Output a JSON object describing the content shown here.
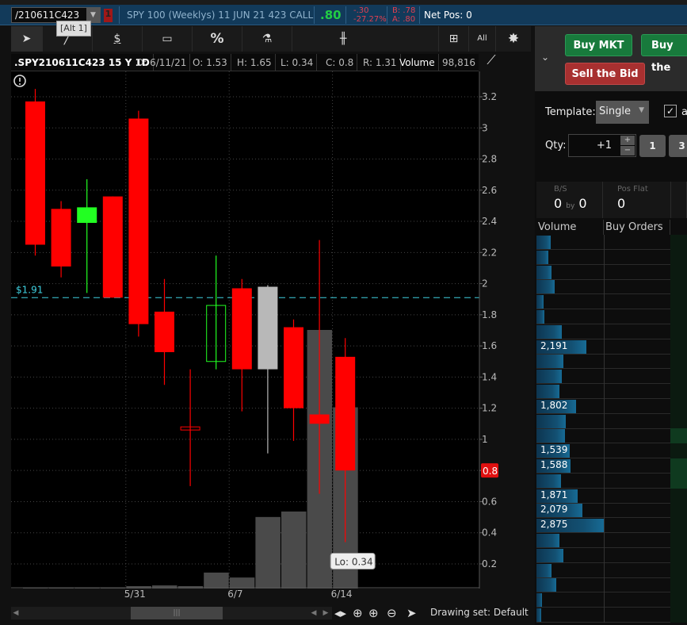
{
  "symbol_bar": {
    "symbol": "/210611C423",
    "link_badge": "1",
    "tooltip": "[Alt 1]",
    "description": "SPY 100 (Weeklys) 11 JUN 21 423 CALL",
    "last": ".80",
    "change": "-.30",
    "change_pct": "-27.27%",
    "bid": "B: .78",
    "ask": "A: .80",
    "net_pos": "Net Pos: 0"
  },
  "toolbar": {
    "icons": [
      "cursor-icon",
      "drawing-pencil-icon",
      "price-dollar-icon",
      "rectangle-icon",
      "percent-icon",
      "studies-flask-icon",
      "chart-style-candle-icon",
      "grid-layout-icon",
      "all-icon",
      "gear-icon"
    ],
    "all_label": "All",
    "percent_label": "%",
    "dollar_label": "$"
  },
  "info": {
    "title": ".SPY210611C423 15 Y 1D",
    "date": "D: 6/11/21",
    "open": "O: 1.53",
    "high": "H: 1.65",
    "low": "L: 0.34",
    "close": "C: 0.8",
    "range": "R: 1.31",
    "volume_label": "Volume",
    "volume_value": "98,816"
  },
  "chart_data": {
    "type": "candlestick",
    "ylim": [
      0.042,
      3.363
    ],
    "yticks": [
      3.2,
      3,
      2.8,
      2.6,
      2.4,
      2.2,
      2,
      1.8,
      1.6,
      1.4,
      1.2,
      1,
      0.8,
      0.6,
      0.4,
      0.2
    ],
    "ytick_labels": [
      "3.2",
      "3",
      "2.8",
      "2.6",
      "2.4",
      "2.2",
      "2",
      "1.8",
      "1.6",
      "1.4",
      "1.2",
      "1",
      "0.8",
      "0.6",
      "0.4",
      "0.2"
    ],
    "xtick_labels": [
      "5/31",
      "6/7",
      "6/14"
    ],
    "xtick_after_index": [
      3,
      7,
      11
    ],
    "candles": [
      {
        "o": 3.17,
        "h": 3.25,
        "l": 2.18,
        "c": 2.25,
        "color": "#ff0000",
        "hollow": false
      },
      {
        "o": 2.48,
        "h": 2.53,
        "l": 2.04,
        "c": 2.11,
        "color": "#ff0000",
        "hollow": false
      },
      {
        "o": 2.39,
        "h": 2.67,
        "l": 1.94,
        "c": 2.49,
        "color": "#22ff22",
        "hollow": false
      },
      {
        "o": 2.56,
        "h": 2.56,
        "l": 1.91,
        "c": 1.91,
        "color": "#ff0000",
        "hollow": false
      },
      {
        "o": 3.06,
        "h": 3.11,
        "l": 1.66,
        "c": 1.74,
        "color": "#ff0000",
        "hollow": false
      },
      {
        "o": 1.82,
        "h": 2.03,
        "l": 1.35,
        "c": 1.56,
        "color": "#ff0000",
        "hollow": false
      },
      {
        "o": 1.06,
        "h": 1.45,
        "l": 0.7,
        "c": 1.08,
        "color": "#ff0000",
        "hollow": true
      },
      {
        "o": 1.5,
        "h": 2.18,
        "l": 1.45,
        "c": 1.86,
        "color": "#22ff22",
        "hollow": true
      },
      {
        "o": 1.97,
        "h": 2.03,
        "l": 1.18,
        "c": 1.45,
        "color": "#ff0000",
        "hollow": false
      },
      {
        "o": 1.98,
        "h": 1.99,
        "l": 0.91,
        "c": 1.45,
        "color": "#b8b8b8",
        "hollow": false
      },
      {
        "o": 1.72,
        "h": 1.77,
        "l": 0.99,
        "c": 1.2,
        "color": "#ff0000",
        "hollow": false
      },
      {
        "o": 1.16,
        "h": 2.28,
        "l": 0.65,
        "c": 1.1,
        "color": "#ff0000",
        "hollow": false
      },
      {
        "o": 1.53,
        "h": 1.65,
        "l": 0.34,
        "c": 0.8,
        "color": "#ff0000",
        "hollow": false
      }
    ],
    "volume_max": 282000,
    "volumes": [
      200,
      300,
      400,
      400,
      1300,
      1700,
      1300,
      8700,
      6000,
      39000,
      42000,
      141000,
      98816
    ],
    "price_line": {
      "value": 1.91,
      "label": "$1.91",
      "color": "#3fd0e0"
    },
    "last_price_label": "0.8",
    "low_callout": "Lo: 0.34"
  },
  "bottom": {
    "drawing_set": "Drawing set: Default"
  },
  "order_panel": {
    "buy_mkt": "Buy MKT",
    "buy_the": "Buy the",
    "sell_bid": "Sell the Bid",
    "template_label": "Template:",
    "template_value": "Single",
    "checkbox_label": "a",
    "qty_label": "Qty:",
    "qty_value": "+1",
    "qty_preset_1": "1",
    "qty_preset_2": "3",
    "bs_label": "B/S",
    "bs_value_a": "0",
    "bs_by": "by",
    "bs_value_b": "0",
    "posflat_label": "Pos Flat",
    "posflat_value": "0",
    "col_volume": "Volume",
    "col_buy_orders": "Buy Orders"
  },
  "ladder": {
    "rows": [
      {
        "vol": "",
        "frac": 0.16
      },
      {
        "vol": "",
        "frac": 0.14
      },
      {
        "vol": "",
        "frac": 0.17
      },
      {
        "vol": "",
        "frac": 0.21
      },
      {
        "vol": "",
        "frac": 0.08
      },
      {
        "vol": "",
        "frac": 0.09
      },
      {
        "vol": "",
        "frac": 0.29
      },
      {
        "vol": "2,191",
        "frac": 0.57
      },
      {
        "vol": "",
        "frac": 0.31
      },
      {
        "vol": "",
        "frac": 0.29
      },
      {
        "vol": "",
        "frac": 0.26
      },
      {
        "vol": "1,802",
        "frac": 0.45
      },
      {
        "vol": "",
        "frac": 0.34
      },
      {
        "vol": "",
        "frac": 0.33
      },
      {
        "vol": "1,539",
        "frac": 0.38
      },
      {
        "vol": "1,588",
        "frac": 0.39
      },
      {
        "vol": "",
        "frac": 0.28
      },
      {
        "vol": "1,871",
        "frac": 0.47
      },
      {
        "vol": "2,079",
        "frac": 0.53
      },
      {
        "vol": "2,875",
        "frac": 0.77
      },
      {
        "vol": "",
        "frac": 0.26
      },
      {
        "vol": "",
        "frac": 0.31
      },
      {
        "vol": "",
        "frac": 0.17
      },
      {
        "vol": "",
        "frac": 0.23
      },
      {
        "vol": "",
        "frac": 0.06
      },
      {
        "vol": "",
        "frac": 0.05
      }
    ],
    "highlight_rows": [
      13,
      15,
      16
    ]
  }
}
